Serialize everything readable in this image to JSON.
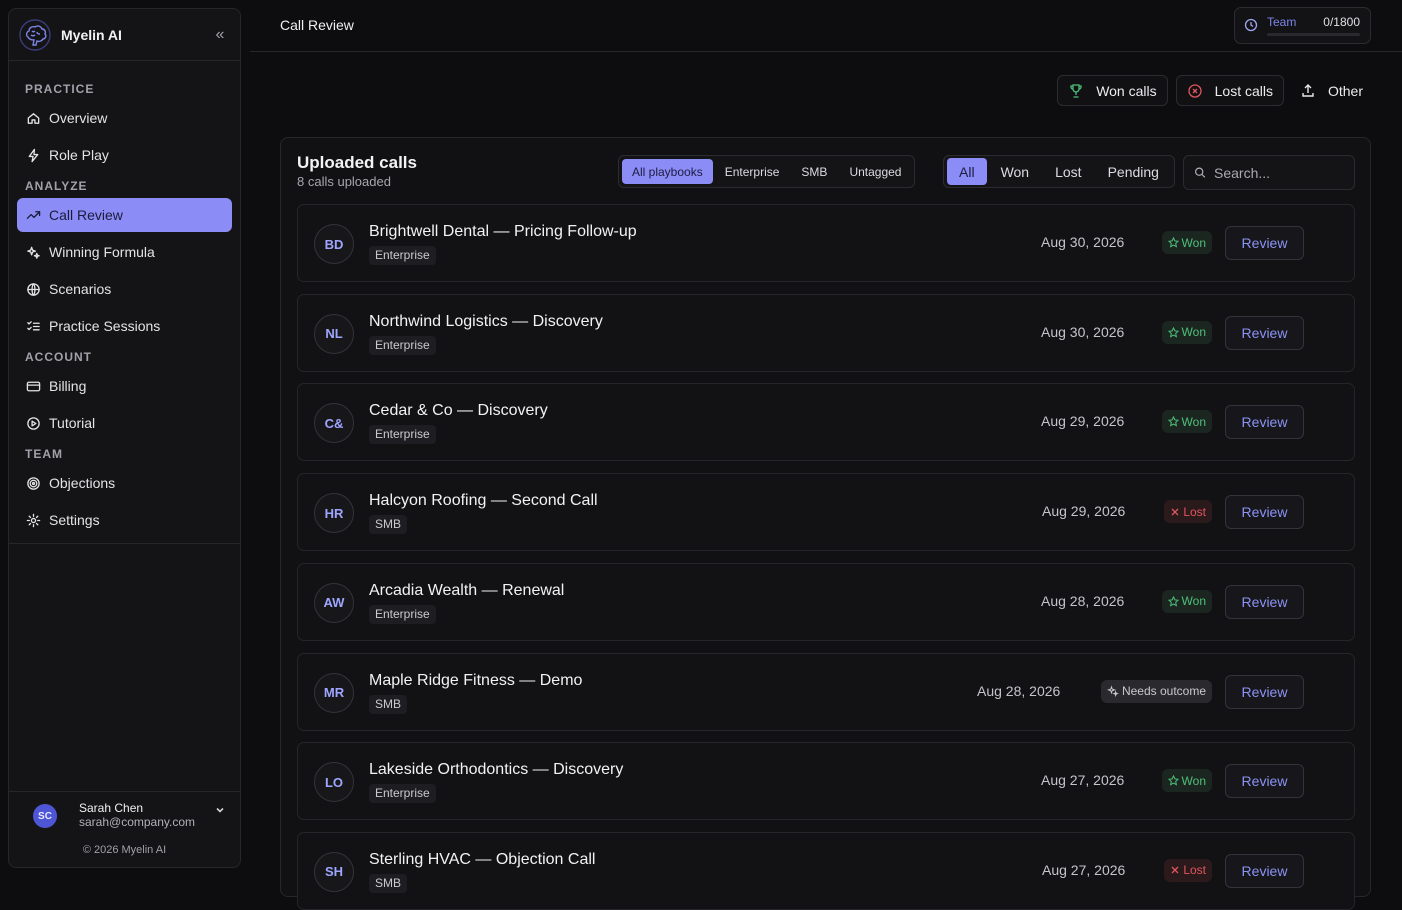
{
  "app": {
    "name": "Myelin AI",
    "collapse_icon": "chevrons-left-icon"
  },
  "sidebar": {
    "sections": [
      {
        "title": "PRACTICE",
        "items": [
          {
            "label": "Overview",
            "icon": "home-icon"
          },
          {
            "label": "Role Play",
            "icon": "bolt-icon"
          }
        ]
      },
      {
        "title": "ANALYZE",
        "items": [
          {
            "label": "Call Review",
            "icon": "trend-icon",
            "active": true
          },
          {
            "label": "Winning Formula",
            "icon": "sparkles-icon"
          },
          {
            "label": "Scenarios",
            "icon": "globe-icon"
          },
          {
            "label": "Practice Sessions",
            "icon": "list-checks-icon"
          }
        ]
      },
      {
        "title": "ACCOUNT",
        "items": [
          {
            "label": "Billing",
            "icon": "credit-card-icon"
          },
          {
            "label": "Tutorial",
            "icon": "play-circle-icon"
          }
        ]
      },
      {
        "title": "TEAM",
        "items": [
          {
            "label": "Objections",
            "icon": "target-icon"
          },
          {
            "label": "Settings",
            "icon": "gear-icon"
          }
        ]
      }
    ],
    "user": {
      "initials": "SC",
      "name": "Sarah Chen",
      "email": "sarah@company.com"
    },
    "copyright": "© 2026 Myelin AI"
  },
  "header": {
    "title": "Call Review",
    "team": {
      "label": "Team",
      "value": "0/1800",
      "progress": 0
    }
  },
  "top_filters": {
    "won": "Won calls",
    "lost": "Lost calls",
    "other": "Other"
  },
  "panel": {
    "title": "Uploaded calls",
    "subtitle": "8 calls uploaded",
    "playbooks": [
      "All playbooks",
      "Enterprise",
      "SMB",
      "Untagged"
    ],
    "playbook_selected": "All playbooks",
    "outcomes": [
      "All",
      "Won",
      "Lost",
      "Pending"
    ],
    "outcome_selected": "All",
    "search_placeholder": "Search...",
    "review_label": "Review"
  },
  "calls": [
    {
      "initials": "BD",
      "title": "Brightwell Dental — Pricing Follow-up",
      "tag": "Enterprise",
      "date": "Aug 30, 2026",
      "status": "Won"
    },
    {
      "initials": "NL",
      "title": "Northwind Logistics — Discovery",
      "tag": "Enterprise",
      "date": "Aug 30, 2026",
      "status": "Won"
    },
    {
      "initials": "C&",
      "title": "Cedar & Co — Discovery",
      "tag": "Enterprise",
      "date": "Aug 29, 2026",
      "status": "Won"
    },
    {
      "initials": "HR",
      "title": "Halcyon Roofing — Second Call",
      "tag": "SMB",
      "date": "Aug 29, 2026",
      "status": "Lost"
    },
    {
      "initials": "AW",
      "title": "Arcadia Wealth — Renewal",
      "tag": "Enterprise",
      "date": "Aug 28, 2026",
      "status": "Won"
    },
    {
      "initials": "MR",
      "title": "Maple Ridge Fitness — Demo",
      "tag": "SMB",
      "date": "Aug 28, 2026",
      "status": "Needs outcome"
    },
    {
      "initials": "LO",
      "title": "Lakeside Orthodontics — Discovery",
      "tag": "Enterprise",
      "date": "Aug 27, 2026",
      "status": "Won"
    },
    {
      "initials": "SH",
      "title": "Sterling HVAC — Objection Call",
      "tag": "SMB",
      "date": "Aug 27, 2026",
      "status": "Lost"
    }
  ]
}
